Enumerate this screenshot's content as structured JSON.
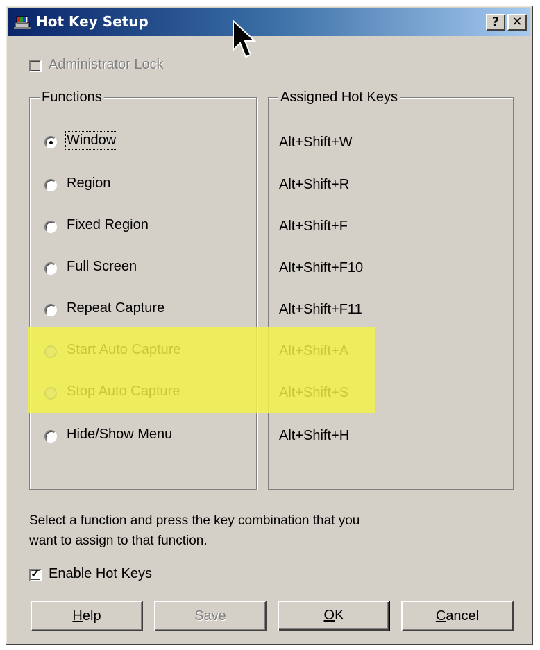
{
  "window": {
    "title": "Hot Key Setup",
    "help_button": "?",
    "close_button": "✕"
  },
  "admin_lock": {
    "label": "Administrator Lock",
    "checked": false,
    "enabled": false
  },
  "functions": {
    "title": "Functions",
    "items": [
      {
        "label": "Window",
        "selected": true,
        "enabled": true
      },
      {
        "label": "Region",
        "selected": false,
        "enabled": true
      },
      {
        "label": "Fixed Region",
        "selected": false,
        "enabled": true
      },
      {
        "label": "Full Screen",
        "selected": false,
        "enabled": true
      },
      {
        "label": "Repeat Capture",
        "selected": false,
        "enabled": true
      },
      {
        "label": "Start Auto Capture",
        "selected": false,
        "enabled": false
      },
      {
        "label": "Stop Auto Capture",
        "selected": false,
        "enabled": false
      },
      {
        "label": "Hide/Show Menu",
        "selected": false,
        "enabled": true
      }
    ]
  },
  "assigned": {
    "title": "Assigned Hot Keys",
    "keys": [
      "Alt+Shift+W",
      "Alt+Shift+R",
      "Alt+Shift+F",
      "Alt+Shift+F10",
      "Alt+Shift+F11",
      "Alt+Shift+A",
      "Alt+Shift+S",
      "Alt+Shift+H"
    ]
  },
  "instructions": {
    "line1": "Select a function and press the key combination that you",
    "line2": "want to assign to that function."
  },
  "enable_hot_keys": {
    "label": "Enable Hot Keys",
    "checked": true
  },
  "buttons": {
    "help": {
      "mnemonic": "H",
      "rest": "elp"
    },
    "save": "Save",
    "ok": {
      "mnemonic": "O",
      "rest": "K"
    },
    "cancel": {
      "mnemonic": "C",
      "rest": "ancel"
    }
  },
  "colors": {
    "highlight": "#f2f24a",
    "titlebar_start": "#0a246a",
    "titlebar_end": "#a6caf0"
  }
}
